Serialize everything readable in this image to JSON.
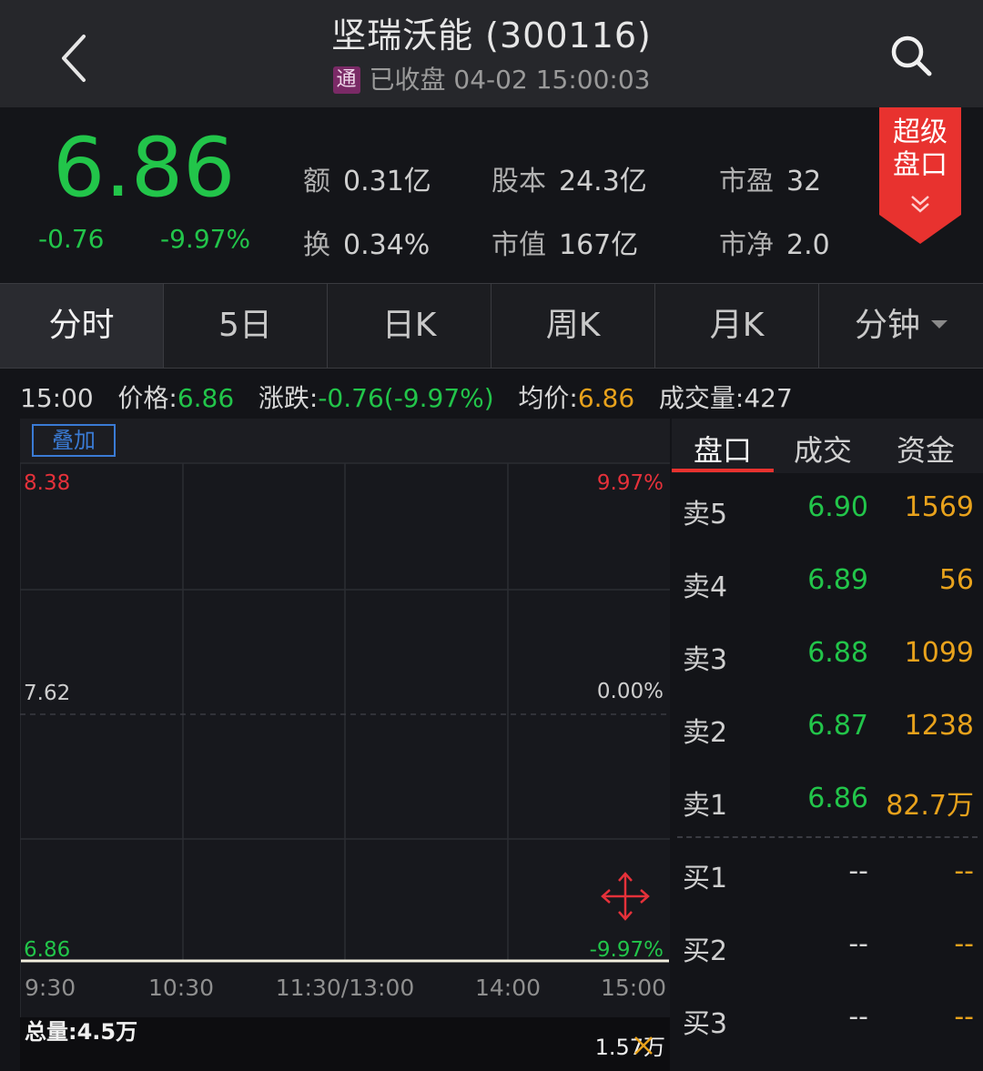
{
  "header": {
    "title": "坚瑞沃能 (300116)",
    "badge": "通",
    "status": "已收盘 04-02 15:00:03"
  },
  "quote": {
    "price": "6.86",
    "change": "-0.76",
    "change_pct": "-9.97%",
    "stats": [
      {
        "key": "额",
        "val": "0.31亿"
      },
      {
        "key": "股本",
        "val": "24.3亿"
      },
      {
        "key": "市盈",
        "val": "32"
      },
      {
        "key": "换",
        "val": "0.34%"
      },
      {
        "key": "市值",
        "val": "167亿"
      },
      {
        "key": "市净",
        "val": "2.0"
      }
    ],
    "super_label_1": "超级",
    "super_label_2": "盘口"
  },
  "tabs": [
    "分时",
    "5日",
    "日K",
    "周K",
    "月K",
    "分钟"
  ],
  "info": {
    "time": "15:00",
    "price_label": "价格:",
    "price": "6.86",
    "change_label": "涨跌:",
    "change": "-0.76(-9.97%)",
    "avg_label": "均价:",
    "avg": "6.86",
    "vol_label": "成交量:",
    "vol": "427"
  },
  "chart": {
    "overlay_button": "叠加",
    "y_high": "8.38",
    "y_mid": "7.62",
    "y_low": "6.86",
    "pct_high": "9.97%",
    "pct_mid": "0.00%",
    "pct_low": "-9.97%",
    "x_labels": [
      "9:30",
      "10:30",
      "11:30/13:00",
      "14:00",
      "15:00"
    ],
    "total_volume": "总量:4.5万",
    "max_volume": "1.57万"
  },
  "chart_data": {
    "type": "line",
    "x": [
      "9:30",
      "10:30",
      "11:30/13:00",
      "14:00",
      "15:00"
    ],
    "series": [
      {
        "values": [
          6.86,
          6.86,
          6.86,
          6.86,
          6.86
        ]
      }
    ],
    "ylim": [
      6.86,
      8.38
    ]
  },
  "book": {
    "tabs": [
      "盘口",
      "成交",
      "资金"
    ],
    "asks": [
      {
        "label": "卖5",
        "price": "6.90",
        "vol": "1569"
      },
      {
        "label": "卖4",
        "price": "6.89",
        "vol": "56"
      },
      {
        "label": "卖3",
        "price": "6.88",
        "vol": "1099"
      },
      {
        "label": "卖2",
        "price": "6.87",
        "vol": "1238"
      },
      {
        "label": "卖1",
        "price": "6.86",
        "vol": "82.7万"
      }
    ],
    "bids": [
      {
        "label": "买1",
        "price": "--",
        "vol": "--"
      },
      {
        "label": "买2",
        "price": "--",
        "vol": "--"
      },
      {
        "label": "买3",
        "price": "--",
        "vol": "--"
      }
    ]
  },
  "colors": {
    "up": "#e5313a",
    "down": "#22c54a",
    "volume": "#e8a21c",
    "accent": "#e8322f"
  }
}
